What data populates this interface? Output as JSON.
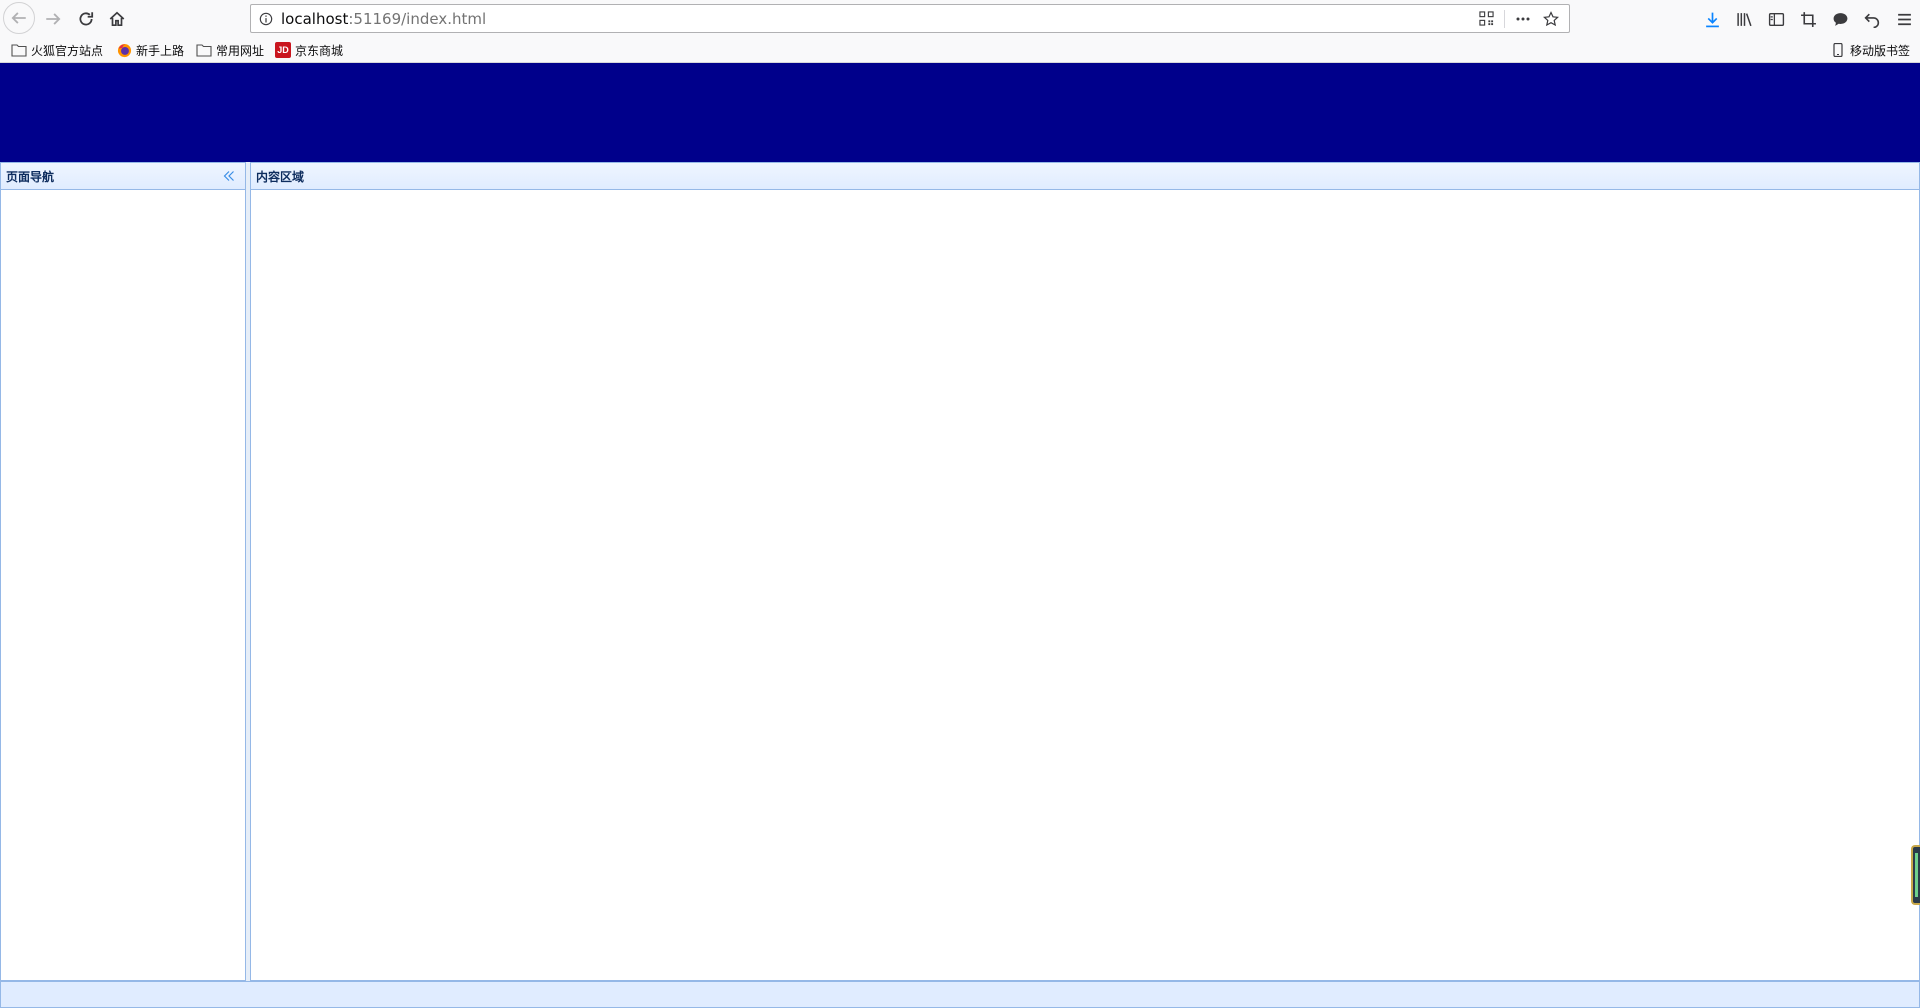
{
  "browser": {
    "url_host": "localhost",
    "url_rest": ":51169/index.html",
    "bookmarks": [
      {
        "label": "火狐官方站点",
        "icon": "folder-icon"
      },
      {
        "label": "新手上路",
        "icon": "firefox-icon"
      },
      {
        "label": "常用网址",
        "icon": "folder-icon"
      },
      {
        "label": "京东商城",
        "icon": "jd-icon",
        "icon_text": "JD"
      }
    ],
    "mobile_bookmarks": "移动版书签",
    "colors": {
      "download_accent": "#0a84ff"
    }
  },
  "page": {
    "header_color": "#00008b",
    "west": {
      "title": "页面导航"
    },
    "center": {
      "title": "内容区域"
    },
    "border_color": "#95b8e7"
  }
}
